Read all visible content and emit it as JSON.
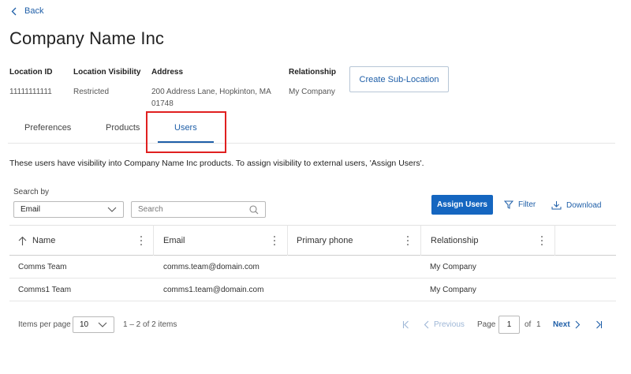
{
  "nav": {
    "back_label": "Back"
  },
  "header": {
    "title": "Company Name Inc"
  },
  "info": {
    "location_id": {
      "label": "Location ID",
      "value": "11111111111"
    },
    "location_visibility": {
      "label": "Location Visibility",
      "value": "Restricted"
    },
    "address": {
      "label": "Address",
      "line1": "200 Address Lane, Hopkinton, MA",
      "line2": "01748"
    },
    "relationship": {
      "label": "Relationship",
      "value": "My Company"
    }
  },
  "actions": {
    "create_sub_location": "Create Sub-Location"
  },
  "tabs": [
    {
      "label": "Preferences"
    },
    {
      "label": "Products"
    },
    {
      "label": "Users",
      "active": true
    }
  ],
  "description": "These users have visibility into Company Name Inc products. To assign visibility to external users, 'Assign Users'.",
  "search": {
    "label": "Search by",
    "field_value": "Email",
    "placeholder": "Search"
  },
  "toolbar": {
    "assign_users": "Assign Users",
    "filter": "Filter",
    "download": "Download"
  },
  "table": {
    "columns": [
      "Name",
      "Email",
      "Primary phone",
      "Relationship"
    ],
    "rows": [
      {
        "name": "Comms Team",
        "email": "comms.team@domain.com",
        "phone": "",
        "relationship": "My Company"
      },
      {
        "name": "Comms1 Team",
        "email": "comms1.team@domain.com",
        "phone": "",
        "relationship": "My Company"
      }
    ]
  },
  "pagination": {
    "items_per_page_label": "Items per page",
    "items_per_page": "10",
    "range": "1 – 2 of 2 items",
    "previous": "Previous",
    "page_label": "Page",
    "page": "1",
    "of_label": "of",
    "total_pages": "1",
    "next": "Next"
  },
  "colors": {
    "accent": "#1566c0",
    "link": "#1f5fa8",
    "highlight": "#e02020"
  }
}
